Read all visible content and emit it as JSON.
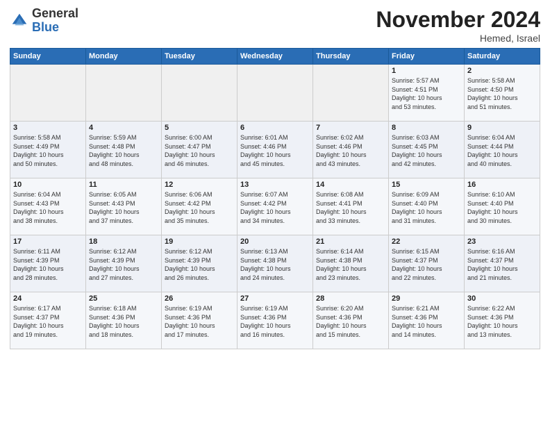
{
  "logo": {
    "text_general": "General",
    "text_blue": "Blue"
  },
  "header": {
    "month": "November 2024",
    "location": "Hemed, Israel"
  },
  "weekdays": [
    "Sunday",
    "Monday",
    "Tuesday",
    "Wednesday",
    "Thursday",
    "Friday",
    "Saturday"
  ],
  "weeks": [
    [
      {
        "day": "",
        "info": ""
      },
      {
        "day": "",
        "info": ""
      },
      {
        "day": "",
        "info": ""
      },
      {
        "day": "",
        "info": ""
      },
      {
        "day": "",
        "info": ""
      },
      {
        "day": "1",
        "info": "Sunrise: 5:57 AM\nSunset: 4:51 PM\nDaylight: 10 hours\nand 53 minutes."
      },
      {
        "day": "2",
        "info": "Sunrise: 5:58 AM\nSunset: 4:50 PM\nDaylight: 10 hours\nand 51 minutes."
      }
    ],
    [
      {
        "day": "3",
        "info": "Sunrise: 5:58 AM\nSunset: 4:49 PM\nDaylight: 10 hours\nand 50 minutes."
      },
      {
        "day": "4",
        "info": "Sunrise: 5:59 AM\nSunset: 4:48 PM\nDaylight: 10 hours\nand 48 minutes."
      },
      {
        "day": "5",
        "info": "Sunrise: 6:00 AM\nSunset: 4:47 PM\nDaylight: 10 hours\nand 46 minutes."
      },
      {
        "day": "6",
        "info": "Sunrise: 6:01 AM\nSunset: 4:46 PM\nDaylight: 10 hours\nand 45 minutes."
      },
      {
        "day": "7",
        "info": "Sunrise: 6:02 AM\nSunset: 4:46 PM\nDaylight: 10 hours\nand 43 minutes."
      },
      {
        "day": "8",
        "info": "Sunrise: 6:03 AM\nSunset: 4:45 PM\nDaylight: 10 hours\nand 42 minutes."
      },
      {
        "day": "9",
        "info": "Sunrise: 6:04 AM\nSunset: 4:44 PM\nDaylight: 10 hours\nand 40 minutes."
      }
    ],
    [
      {
        "day": "10",
        "info": "Sunrise: 6:04 AM\nSunset: 4:43 PM\nDaylight: 10 hours\nand 38 minutes."
      },
      {
        "day": "11",
        "info": "Sunrise: 6:05 AM\nSunset: 4:43 PM\nDaylight: 10 hours\nand 37 minutes."
      },
      {
        "day": "12",
        "info": "Sunrise: 6:06 AM\nSunset: 4:42 PM\nDaylight: 10 hours\nand 35 minutes."
      },
      {
        "day": "13",
        "info": "Sunrise: 6:07 AM\nSunset: 4:42 PM\nDaylight: 10 hours\nand 34 minutes."
      },
      {
        "day": "14",
        "info": "Sunrise: 6:08 AM\nSunset: 4:41 PM\nDaylight: 10 hours\nand 33 minutes."
      },
      {
        "day": "15",
        "info": "Sunrise: 6:09 AM\nSunset: 4:40 PM\nDaylight: 10 hours\nand 31 minutes."
      },
      {
        "day": "16",
        "info": "Sunrise: 6:10 AM\nSunset: 4:40 PM\nDaylight: 10 hours\nand 30 minutes."
      }
    ],
    [
      {
        "day": "17",
        "info": "Sunrise: 6:11 AM\nSunset: 4:39 PM\nDaylight: 10 hours\nand 28 minutes."
      },
      {
        "day": "18",
        "info": "Sunrise: 6:12 AM\nSunset: 4:39 PM\nDaylight: 10 hours\nand 27 minutes."
      },
      {
        "day": "19",
        "info": "Sunrise: 6:12 AM\nSunset: 4:39 PM\nDaylight: 10 hours\nand 26 minutes."
      },
      {
        "day": "20",
        "info": "Sunrise: 6:13 AM\nSunset: 4:38 PM\nDaylight: 10 hours\nand 24 minutes."
      },
      {
        "day": "21",
        "info": "Sunrise: 6:14 AM\nSunset: 4:38 PM\nDaylight: 10 hours\nand 23 minutes."
      },
      {
        "day": "22",
        "info": "Sunrise: 6:15 AM\nSunset: 4:37 PM\nDaylight: 10 hours\nand 22 minutes."
      },
      {
        "day": "23",
        "info": "Sunrise: 6:16 AM\nSunset: 4:37 PM\nDaylight: 10 hours\nand 21 minutes."
      }
    ],
    [
      {
        "day": "24",
        "info": "Sunrise: 6:17 AM\nSunset: 4:37 PM\nDaylight: 10 hours\nand 19 minutes."
      },
      {
        "day": "25",
        "info": "Sunrise: 6:18 AM\nSunset: 4:36 PM\nDaylight: 10 hours\nand 18 minutes."
      },
      {
        "day": "26",
        "info": "Sunrise: 6:19 AM\nSunset: 4:36 PM\nDaylight: 10 hours\nand 17 minutes."
      },
      {
        "day": "27",
        "info": "Sunrise: 6:19 AM\nSunset: 4:36 PM\nDaylight: 10 hours\nand 16 minutes."
      },
      {
        "day": "28",
        "info": "Sunrise: 6:20 AM\nSunset: 4:36 PM\nDaylight: 10 hours\nand 15 minutes."
      },
      {
        "day": "29",
        "info": "Sunrise: 6:21 AM\nSunset: 4:36 PM\nDaylight: 10 hours\nand 14 minutes."
      },
      {
        "day": "30",
        "info": "Sunrise: 6:22 AM\nSunset: 4:36 PM\nDaylight: 10 hours\nand 13 minutes."
      }
    ]
  ]
}
